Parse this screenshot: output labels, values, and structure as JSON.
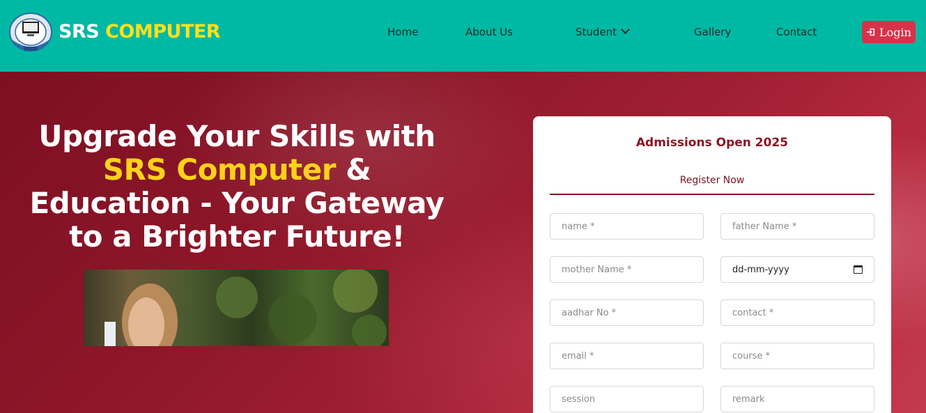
{
  "header": {
    "brand_part1": "SRS",
    "brand_part2": "COMPUTER",
    "nav": [
      "Home",
      "About Us",
      "Student",
      "Gallery",
      "Contact"
    ],
    "login_label": "Login"
  },
  "hero": {
    "title_part1": "Upgrade Your Skills with",
    "title_highlight": "SRS Computer",
    "title_part2": "& Education - Your Gateway to a Brighter Future!"
  },
  "form": {
    "title": "Admissions Open 2025",
    "tab": "Register Now",
    "fields": {
      "name": "name *",
      "father_name": "father Name *",
      "mother_name": "mother Name *",
      "dob": "dd-mm-yyyy",
      "aadhar": "aadhar No *",
      "contact": "contact *",
      "email": "email *",
      "course": "course *",
      "session": "session",
      "remark": "remark"
    }
  },
  "colors": {
    "header_bg": "#00b9a4",
    "brand_yellow": "#ffe01a",
    "login_red": "#d8324a",
    "accent_maroon": "#8b1423"
  }
}
